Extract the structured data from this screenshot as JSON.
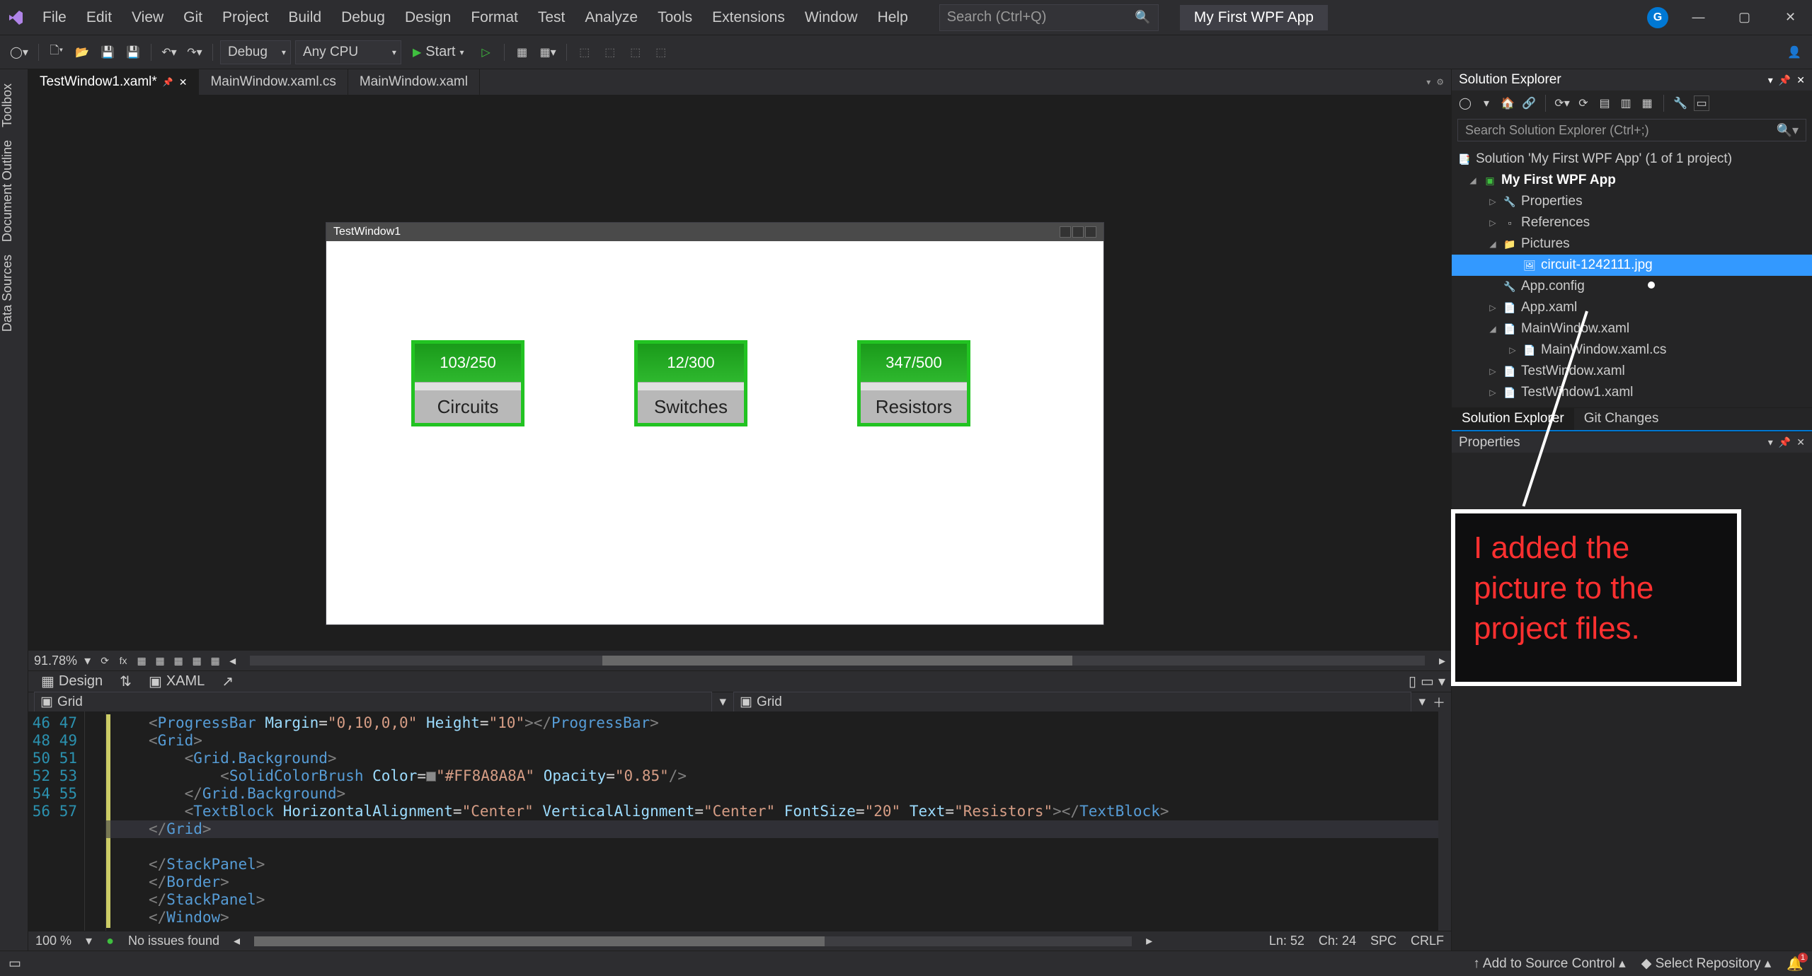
{
  "menu": [
    "File",
    "Edit",
    "View",
    "Git",
    "Project",
    "Build",
    "Debug",
    "Design",
    "Format",
    "Test",
    "Analyze",
    "Tools",
    "Extensions",
    "Window",
    "Help"
  ],
  "search_placeholder": "Search (Ctrl+Q)",
  "app_title": "My First WPF App",
  "avatar_initial": "G",
  "toolbar": {
    "config": "Debug",
    "platform": "Any CPU",
    "start": "Start"
  },
  "left_rail": [
    "Toolbox",
    "Document Outline",
    "Data Sources"
  ],
  "tabs": [
    {
      "label": "TestWindow1.xaml*",
      "active": true,
      "pinned": true
    },
    {
      "label": "MainWindow.xaml.cs",
      "active": false
    },
    {
      "label": "MainWindow.xaml",
      "active": false
    }
  ],
  "designer": {
    "window_title": "TestWindow1",
    "cards": [
      {
        "value": "103/250",
        "label": "Circuits"
      },
      {
        "value": "12/300",
        "label": "Switches"
      },
      {
        "value": "347/500",
        "label": "Resistors"
      }
    ],
    "zoom": "91.78%"
  },
  "split": {
    "design": "Design",
    "xaml": "XAML"
  },
  "crumb_left": "Grid",
  "crumb_right": "Grid",
  "code": {
    "lines": [
      46,
      47,
      48,
      49,
      50,
      51,
      52,
      53,
      54,
      55,
      56,
      57
    ],
    "l46": "<ProgressBar Margin=\"0,10,0,0\" Height=\"10\"></ProgressBar>",
    "l47": "<Grid>",
    "l48": "<Grid.Background>",
    "l49": "<SolidColorBrush Color=\"#FF8A8A8A\" Opacity=\"0.85\"/>",
    "l49_color": "#FF8A8A8A",
    "l49_opacity": "0.85",
    "l50": "</Grid.Background>",
    "l51_text": "Resistors",
    "l51_fs": "20",
    "l52": "</Grid>",
    "l53": "</StackPanel>",
    "l54": "</Border>",
    "l55": "</StackPanel>",
    "l56": "</Window>"
  },
  "editor_status": {
    "zoom": "100 %",
    "issues": "No issues found",
    "ln": "Ln: 52",
    "ch": "Ch: 24",
    "spc": "SPC",
    "crlf": "CRLF"
  },
  "solution_explorer": {
    "title": "Solution Explorer",
    "search_placeholder": "Search Solution Explorer (Ctrl+;)",
    "root": "Solution 'My First WPF App' (1 of 1 project)",
    "project": "My First WPF App",
    "items": {
      "properties": "Properties",
      "references": "References",
      "pictures": "Pictures",
      "picture_file": "circuit-1242111.jpg",
      "appconfig": "App.config",
      "appxaml": "App.xaml",
      "mainxaml": "MainWindow.xaml",
      "mainxamlcs": "MainWindow.xaml.cs",
      "testwindow": "TestWindow.xaml",
      "testwindow1": "TestWindow1.xaml"
    },
    "bottom_tabs": [
      "Solution Explorer",
      "Git Changes"
    ]
  },
  "properties_title": "Properties",
  "annotation_text": "I added the picture to the project files.",
  "statusbar": {
    "add_source": "Add to Source Control",
    "select_repo": "Select Repository",
    "notif": "1"
  }
}
